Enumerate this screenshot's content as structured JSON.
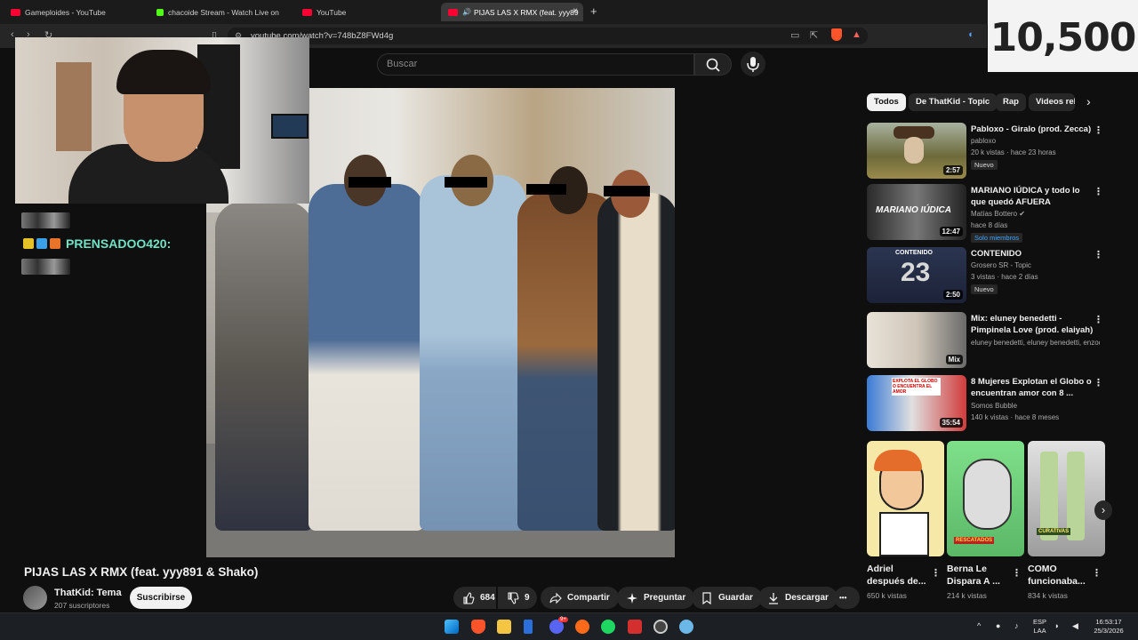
{
  "browser": {
    "tabs": [
      {
        "label": "Gameploides - YouTube",
        "active": false
      },
      {
        "label": "chacoide Stream - Watch Live on",
        "active": false
      },
      {
        "label": "YouTube",
        "active": false
      },
      {
        "label": "PIJAS LAS X RMX (feat. yyy89",
        "active": true
      }
    ],
    "new_tab": "+",
    "close": "×",
    "url": "youtube.com/watch?v=748bZ8FWd4g"
  },
  "overlay": {
    "counter": "10,500"
  },
  "search": {
    "placeholder": "Buscar"
  },
  "chat": {
    "username": "PRENSADOO420:"
  },
  "video": {
    "title": "PIJAS LAS X RMX (feat. yyy891 & Shako)",
    "channel": "ThatKid: Tema",
    "subscribers": "207 suscriptores",
    "subscribe_label": "Suscribirse",
    "likes": "684",
    "dislikes": "9",
    "share": "Compartir",
    "ask": "Preguntar",
    "save": "Guardar",
    "download": "Descargar",
    "more": "•••"
  },
  "chips": [
    "Todos",
    "De ThatKid - Topic",
    "Rap",
    "Videos rel"
  ],
  "recommendations": [
    {
      "title": "Pabloxo - Giralo (prod. Zecca)",
      "channel": "pabloxo",
      "meta": "20 k vistas · hace 23 horas",
      "badge": "Nuevo",
      "duration": "2:57"
    },
    {
      "title": "MARIANO IÚDICA y todo lo que quedó AFUERA",
      "channel": "Matías Bottero ✔",
      "meta": "hace 8 días",
      "badge": "Solo miembros",
      "duration": "12:47"
    },
    {
      "title": "CONTENIDO",
      "channel": "Grosero SR - Topic",
      "meta": "3 vistas · hace 2 días",
      "badge": "Nuevo",
      "duration": "2:50"
    },
    {
      "title": "Mix: eluney benedetti - Pimpinela Love (prod. elaiyah)",
      "channel": "eluney benedetti, eluney benedetti, enzoc...",
      "meta": "",
      "badge": "",
      "duration": "Mix"
    },
    {
      "title": "8 Mujeres Explotan el Globo o encuentran amor con 8 ...",
      "channel": "Somos Bubble",
      "meta": "140 k vistas · hace 8 meses",
      "badge": "",
      "duration": "35:54"
    }
  ],
  "thumb_text": {
    "mariano": "MARIANO IÚDICA",
    "contenido": "CONTENIDO",
    "bubble": "EXPLOTA EL GLOBO O ENCUENTRA EL AMOR",
    "short_sign": "RESCATADOS",
    "short_brand": "CURATIVAS"
  },
  "shorts": [
    {
      "title": "Adriel después de...",
      "views": "650 k vistas"
    },
    {
      "title": "Berna Le Dispara A ...",
      "views": "214 k vistas"
    },
    {
      "title": "COMO funcionaba...",
      "views": "834 k vistas"
    }
  ],
  "taskbar": {
    "lang1": "ESP",
    "lang2": "LAA",
    "time": "16:53:17",
    "date": "25/3/2026",
    "notif": "9+"
  },
  "colors": {
    "accent": "#ff0000",
    "chat_user": "#6fe3c4",
    "members": "#3ea6ff"
  }
}
